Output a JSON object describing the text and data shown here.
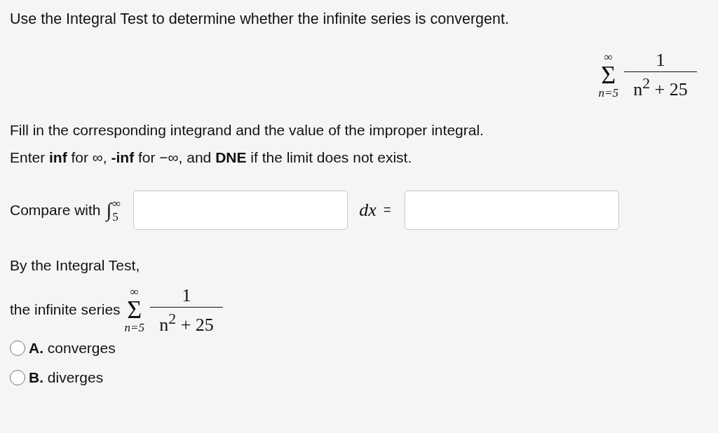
{
  "title": "Use the Integral Test to determine whether the infinite series is convergent.",
  "series_display": {
    "upper": "∞",
    "sigma": "Σ",
    "lower": "n=5",
    "numerator": "1",
    "denominator": "n$^{2}$ + 25"
  },
  "instructions": [
    "Fill in the corresponding integrand and the value of the improper integral.",
    "Enter **inf** for ∞, **-inf** for −∞, and **DNE** if the limit does not exist."
  ],
  "compare": {
    "label": "Compare with",
    "integral": "∫",
    "lower": "5",
    "upper": "∞",
    "differential": "dx",
    "equals": "="
  },
  "conclusion_heading": "By the Integral Test,",
  "conclusion": {
    "label": "the infinite series",
    "upper": "∞",
    "sigma": "Σ",
    "lower": "n=5",
    "numerator": "1",
    "denominator": "n$^{2}$ + 25"
  },
  "options": [
    {
      "text": "**A.** converges",
      "selected": false
    },
    {
      "text": "**B.** diverges",
      "selected": false
    }
  ]
}
